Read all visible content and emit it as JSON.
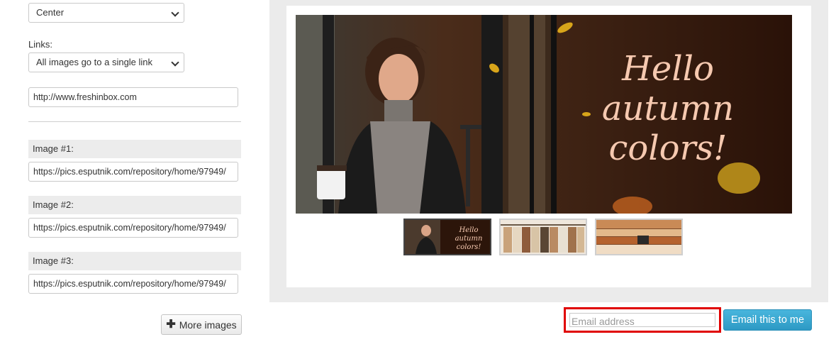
{
  "settings": {
    "alignment_value": "Center",
    "links_label": "Links:",
    "links_value": "All images go to a single link",
    "link_url": "http://www.freshinbox.com",
    "images": [
      {
        "label": "Image #1:",
        "url": "https://pics.esputnik.com/repository/home/97949/"
      },
      {
        "label": "Image #2:",
        "url": "https://pics.esputnik.com/repository/home/97949/"
      },
      {
        "label": "Image #3:",
        "url": "https://pics.esputnik.com/repository/home/97949/"
      }
    ],
    "more_images_label": "More images"
  },
  "preview": {
    "hero_text": [
      "Hello",
      "autumn",
      "colors!"
    ],
    "thumb_text": [
      "Hello",
      "autumn",
      "colors!"
    ]
  },
  "email": {
    "placeholder": "Email address",
    "button_label": "Email this to me"
  },
  "colors": {
    "accent": "#2d99c4",
    "highlight_border": "#e00000",
    "hero_text": "#f6c9b0"
  }
}
